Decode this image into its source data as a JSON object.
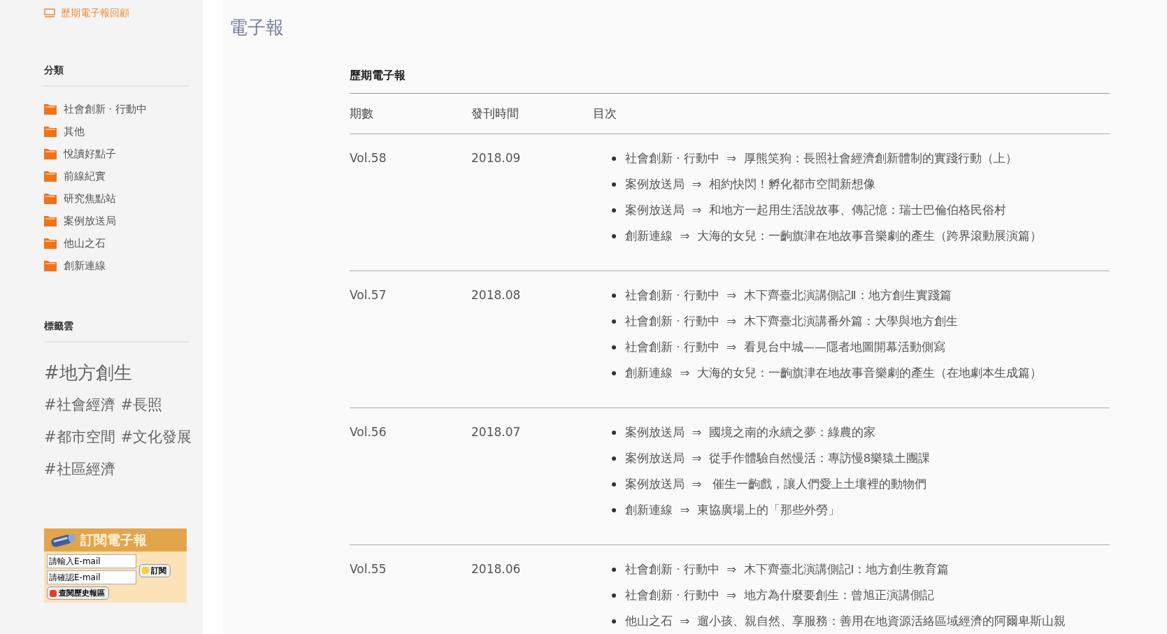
{
  "sidebar": {
    "archive_link": "歷期電子報回顧",
    "categories": {
      "title": "分類",
      "items": [
        "社會創新 · 行動中",
        "其他",
        "悅讀好點子",
        "前線紀實",
        "研究焦點站",
        "案例放送局",
        "他山之石",
        "創新連線"
      ]
    },
    "tag_cloud": {
      "title": "標籤雲",
      "tags": [
        {
          "text": "#地方創生",
          "kind": "large"
        },
        {
          "text": "#社會經濟",
          "kind": "normal"
        },
        {
          "text": "#長照",
          "kind": "normal"
        },
        {
          "text": "#都市空間",
          "kind": "normal"
        },
        {
          "text": "#文化發展",
          "kind": "normal"
        },
        {
          "text": "#社區經濟",
          "kind": "normal"
        }
      ]
    },
    "subscribe": {
      "title": "訂閱電子報",
      "email_value": "請輸入E-mail",
      "confirm_value": "請確認E-mail",
      "subscribe_button": "訂閱",
      "history_button": "查閱歷史報區"
    }
  },
  "main": {
    "page_title": "電子報",
    "section_title": "歷期電子報",
    "columns": [
      "期數",
      "發刊時間",
      "目次"
    ],
    "rows": [
      {
        "issue": "Vol.58",
        "date": "2018.09",
        "articles": [
          "社會創新 · 行動中  ⇒  厚熊笑狗：長照社會經濟創新體制的實踐行動（上）",
          "案例放送局  ⇒  相約快閃！孵化都市空間新想像",
          "案例放送局  ⇒  和地方一起用生活說故事、傳記憶：瑞士巴倫伯格民俗村",
          "創新連線  ⇒  大海的女兒：一齣旗津在地故事音樂劇的產生（跨界滾動展演篇）"
        ]
      },
      {
        "issue": "Vol.57",
        "date": "2018.08",
        "articles": [
          "社會創新 · 行動中  ⇒  木下齊臺北演講側記Ⅱ：地方創生實踐篇",
          "社會創新 · 行動中  ⇒  木下齊臺北演講番外篇：大學與地方創生",
          "社會創新 · 行動中  ⇒  看見台中城——隱者地圖開幕活動側寫",
          "創新連線  ⇒  大海的女兒：一齣旗津在地故事音樂劇的產生（在地劇本生成篇）"
        ]
      },
      {
        "issue": "Vol.56",
        "date": "2018.07",
        "articles": [
          "案例放送局  ⇒  國境之南的永續之夢：綠農的家",
          "案例放送局  ⇒  從手作體驗自然慢活：專訪慢8樂猿土團課",
          "案例放送局  ⇒   催生一齣戲，讓人們愛上土壤裡的動物們",
          "創新連線  ⇒  東協廣場上的「那些外勞」"
        ]
      },
      {
        "issue": "Vol.55",
        "date": "2018.06",
        "articles": [
          "社會創新 · 行動中  ⇒  木下齊臺北演講側記Ⅰ：地方創生教育篇",
          "社會創新 · 行動中  ⇒  地方為什麼要創生：曾旭正演講側記",
          "他山之石  ⇒  遛小孩、親自然、享服務：善用在地資源活絡區域經濟的阿爾卑斯山親"
        ]
      }
    ]
  }
}
